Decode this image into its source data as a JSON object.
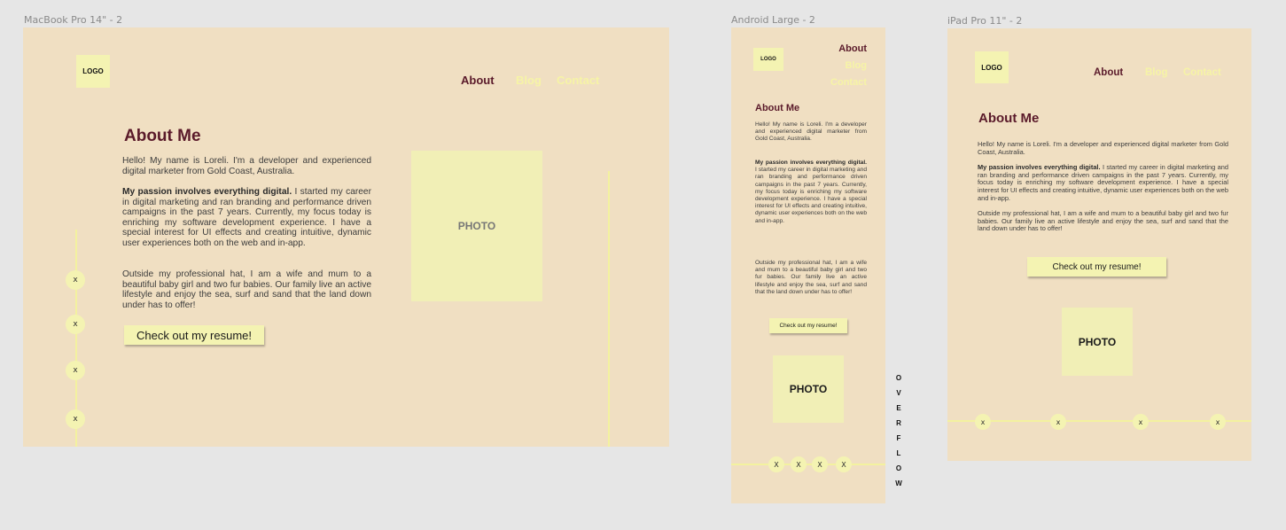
{
  "frames": {
    "desktop": {
      "label": "MacBook Pro 14\" - 2"
    },
    "android": {
      "label": "Android Large - 2"
    },
    "ipad": {
      "label": "iPad Pro 11\" - 2"
    }
  },
  "logo_text": "LOGO",
  "nav": {
    "about": "About",
    "blog": "Blog",
    "contact": "Contact"
  },
  "about": {
    "heading": "About Me",
    "intro": "Hello! My name is Loreli. I'm a developer and experienced digital marketer from Gold Coast, Australia.",
    "passion_bold": "My passion involves everything digital.",
    "passion_rest": " I started my career in digital marketing and ran branding and performance driven campaigns in the past 7 years. Currently, my focus today is enriching my software development experience. I have a special interest for UI effects and creating intuitive, dynamic user experiences both on the web and in-app.",
    "outside": "Outside my professional hat, I am a wife and mum to a beautiful baby girl and two fur babies. Our family live an active lifestyle and enjoy the sea, surf and sand that the land down under has to offer!"
  },
  "resume_button": "Check out my resume!",
  "photo_label": "PHOTO",
  "social_icon": "x",
  "social_icon_upper": "X",
  "overflow_letters": [
    "O",
    "V",
    "E",
    "R",
    "F",
    "L",
    "O",
    "W"
  ],
  "colors": {
    "background": "#f0dfc2",
    "accent": "#f4f3b2",
    "heading": "#5a1a2a",
    "canvas": "#e6e6e6"
  }
}
